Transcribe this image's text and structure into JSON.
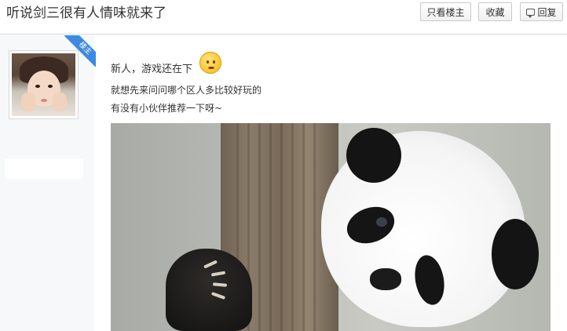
{
  "header": {
    "title": "听说剑三很有人情味就来了",
    "buttons": {
      "only_op": "只看楼主",
      "favorite": "收藏",
      "reply": "回复"
    }
  },
  "post": {
    "badge": "楼主",
    "lines": [
      "新人，游戏还在下",
      "就想先来问问哪个区人多比较好玩的",
      "有没有小伙伴推荐一下呀~"
    ]
  },
  "icons": {
    "reply": "speech-bubble-icon",
    "emoji": "worried-face-emoji"
  },
  "colors": {
    "badge": "#3d8be0",
    "sidebar_bg": "#f7f8fa",
    "text": "#333333"
  }
}
